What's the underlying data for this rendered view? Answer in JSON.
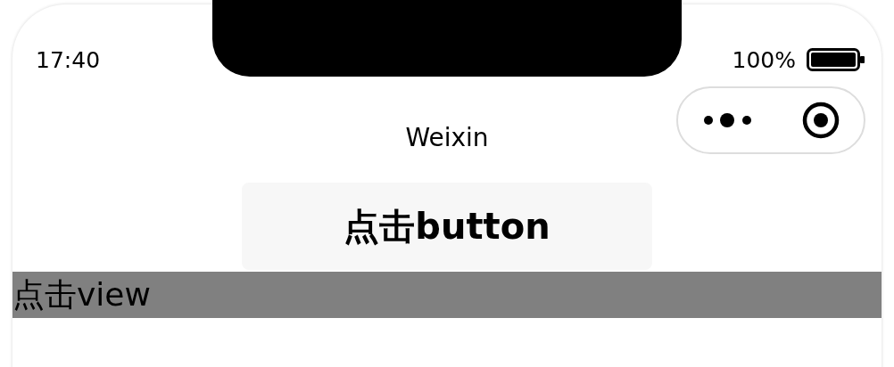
{
  "status_bar": {
    "time": "17:40",
    "battery": "100%"
  },
  "nav_bar": {
    "title": "Weixin"
  },
  "button": {
    "label": "点击button"
  },
  "view": {
    "text": "点击view"
  }
}
